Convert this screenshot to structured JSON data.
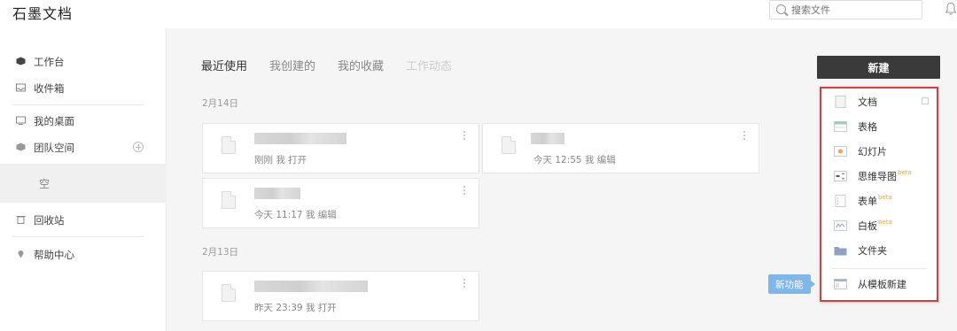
{
  "app": {
    "title": "石墨文档"
  },
  "search": {
    "placeholder": "搜索文件"
  },
  "sidebar": {
    "items": [
      {
        "label": "工作台"
      },
      {
        "label": "收件箱"
      },
      {
        "label": "我的桌面"
      },
      {
        "label": "团队空间"
      },
      {
        "label": "回收站"
      },
      {
        "label": "帮助中心"
      }
    ],
    "empty_label": "空"
  },
  "tabs": [
    {
      "label": "最近使用",
      "active": true
    },
    {
      "label": "我创建的"
    },
    {
      "label": "我的收藏"
    },
    {
      "label": "工作动态"
    }
  ],
  "sections": [
    {
      "date": "2月14日",
      "files": [
        {
          "meta": "刚刚 我 打开"
        },
        {
          "meta": "今天 12:55 我 编辑"
        },
        {
          "meta": "今天 11:17 我 编辑"
        }
      ]
    },
    {
      "date": "2月13日",
      "files": [
        {
          "meta": "昨天 23:39 我 打开"
        }
      ]
    }
  ],
  "new_button": {
    "label": "新建"
  },
  "new_menu": {
    "items": [
      {
        "label": "文档",
        "icon": "doc-icon"
      },
      {
        "label": "表格",
        "icon": "sheet-icon"
      },
      {
        "label": "幻灯片",
        "icon": "slides-icon"
      },
      {
        "label": "思维导图",
        "icon": "mindmap-icon",
        "badge": "beta"
      },
      {
        "label": "表单",
        "icon": "form-icon",
        "badge": "beta"
      },
      {
        "label": "白板",
        "icon": "whiteboard-icon",
        "badge": "beta"
      },
      {
        "label": "文件夹",
        "icon": "folder-icon"
      },
      {
        "label": "从模板新建",
        "icon": "template-icon"
      }
    ]
  },
  "new_feature_tag": {
    "label": "新功能"
  },
  "colors": {
    "accent_dark": "#3a3a3a",
    "highlight_border": "#e53935",
    "new_feature_bg": "#7fb7ea"
  }
}
